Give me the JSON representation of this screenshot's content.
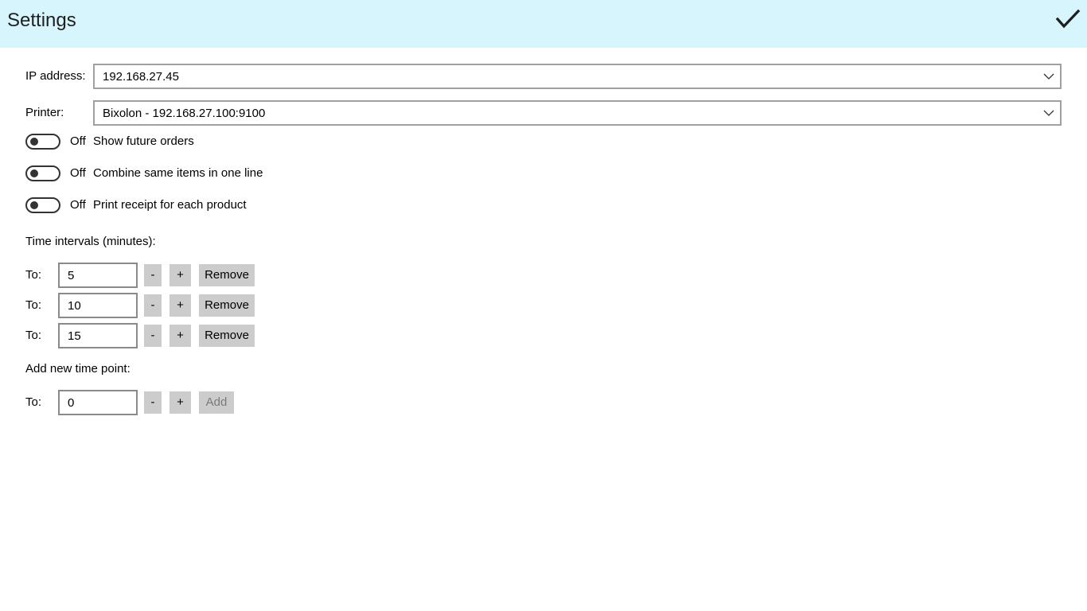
{
  "header": {
    "title": "Settings",
    "accept_icon": "checkmark-icon"
  },
  "ip_address": {
    "label": "IP address:",
    "value": "192.168.27.45"
  },
  "printer": {
    "label": "Printer:",
    "value": "Bixolon - 192.168.27.100:9100"
  },
  "toggles": [
    {
      "state": "Off",
      "label": "Show future orders"
    },
    {
      "state": "Off",
      "label": "Combine same items in one line"
    },
    {
      "state": "Off",
      "label": "Print receipt for each product"
    }
  ],
  "time_intervals": {
    "heading": "Time intervals (minutes):",
    "rows": [
      {
        "label": "To:",
        "value": "5",
        "minus": "-",
        "plus": "+",
        "remove": "Remove"
      },
      {
        "label": "To:",
        "value": "10",
        "minus": "-",
        "plus": "+",
        "remove": "Remove"
      },
      {
        "label": "To:",
        "value": "15",
        "minus": "-",
        "plus": "+",
        "remove": "Remove"
      }
    ]
  },
  "new_time_point": {
    "heading": "Add new time point:",
    "label": "To:",
    "value": "0",
    "minus": "-",
    "plus": "+",
    "add": "Add"
  },
  "colors": {
    "header_bg": "#d6f5fd",
    "button_bg": "#cccccc",
    "disabled_text": "#7a7a7a"
  }
}
